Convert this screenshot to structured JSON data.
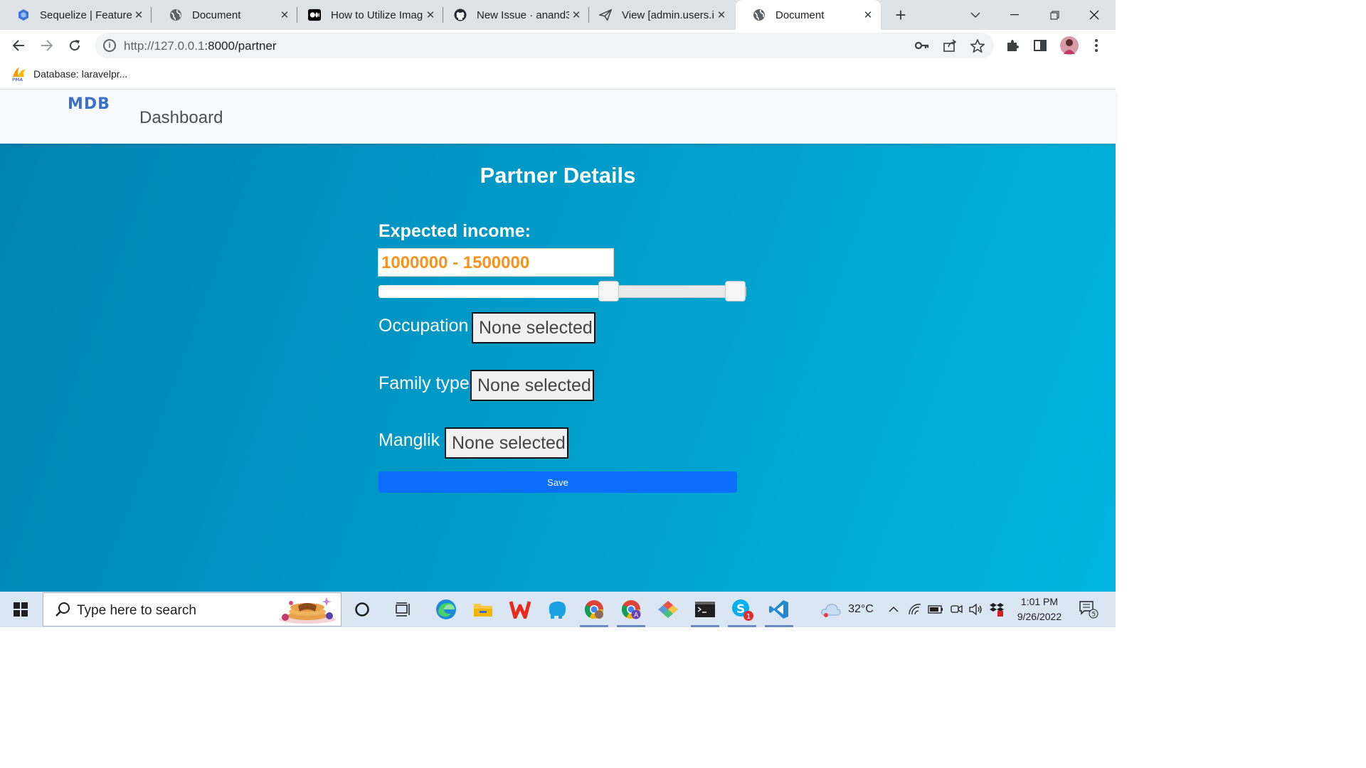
{
  "browser": {
    "tabs": [
      {
        "title": "Sequelize | Feature",
        "icon": "sequelize-icon"
      },
      {
        "title": "Document",
        "icon": "globe-icon"
      },
      {
        "title": "How to Utilize Imag",
        "icon": "medium-icon"
      },
      {
        "title": "New Issue · anand3",
        "icon": "github-icon"
      },
      {
        "title": "View [admin.users.i",
        "icon": "paper-plane-icon"
      },
      {
        "title": "Document",
        "icon": "globe-icon",
        "active": true
      }
    ],
    "url_host": "http://127.0.0.1",
    "url_path": ":8000/partner",
    "bookmark": "Database: laravelpr..."
  },
  "navbar": {
    "logo": "MDB",
    "link": "Dashboard"
  },
  "form": {
    "title": "Partner Details",
    "income_label": "Expected income:",
    "income_value": "1000000 - 1500000",
    "slider": {
      "low_fraction": 0.625,
      "high_fraction": 0.97
    },
    "occupation_label": "Occupation",
    "occupation_value": "None selected",
    "family_label": "Family type",
    "family_value": "None selected",
    "manglik_label": "Manglik",
    "manglik_value": "None selected",
    "save_label": "Save"
  },
  "taskbar": {
    "search_placeholder": "Type here to search",
    "temperature": "32°C",
    "time": "1:01 PM",
    "date": "9/26/2022",
    "notification_count": "5",
    "skype_badge": "1"
  },
  "colors": {
    "accent_orange": "#f6931f",
    "save_blue": "#0d6efd",
    "page_gradient_start": "#0082b1",
    "page_gradient_end": "#00b6e0"
  }
}
